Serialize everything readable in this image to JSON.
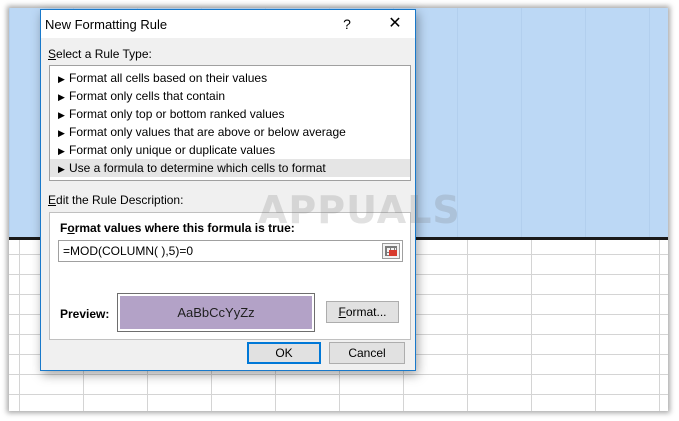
{
  "dialog": {
    "title": "New Formatting Rule",
    "help_glyph": "?",
    "close_glyph": "✕"
  },
  "rule_type": {
    "label": "Select a Rule Type:",
    "label_underline": "S",
    "label_rest": "elect a Rule Type:",
    "items": [
      {
        "label": "Format all cells based on their values",
        "selected": false
      },
      {
        "label": "Format only cells that contain",
        "selected": false
      },
      {
        "label": "Format only top or bottom ranked values",
        "selected": false
      },
      {
        "label": "Format only values that are above or below average",
        "selected": false
      },
      {
        "label": "Format only unique or duplicate values",
        "selected": false
      },
      {
        "label": "Use a formula to determine which cells to format",
        "selected": true
      }
    ],
    "bullet": "▶"
  },
  "description": {
    "label_underline": "E",
    "label_rest": "dit the Rule Description:",
    "heading_underline": "o",
    "heading_pre": "F",
    "heading_rest": "rmat values where this formula is true:",
    "formula": "=MOD(COLUMN( ),5)=0",
    "preview_label": "Preview:",
    "preview_text": "AaBbCcYyZz",
    "preview_fill": "#b3a2c7",
    "format_pre": "",
    "format_underline": "F",
    "format_rest": "ormat..."
  },
  "buttons": {
    "ok": "OK",
    "cancel": "Cancel"
  },
  "watermark": "APPUALS"
}
